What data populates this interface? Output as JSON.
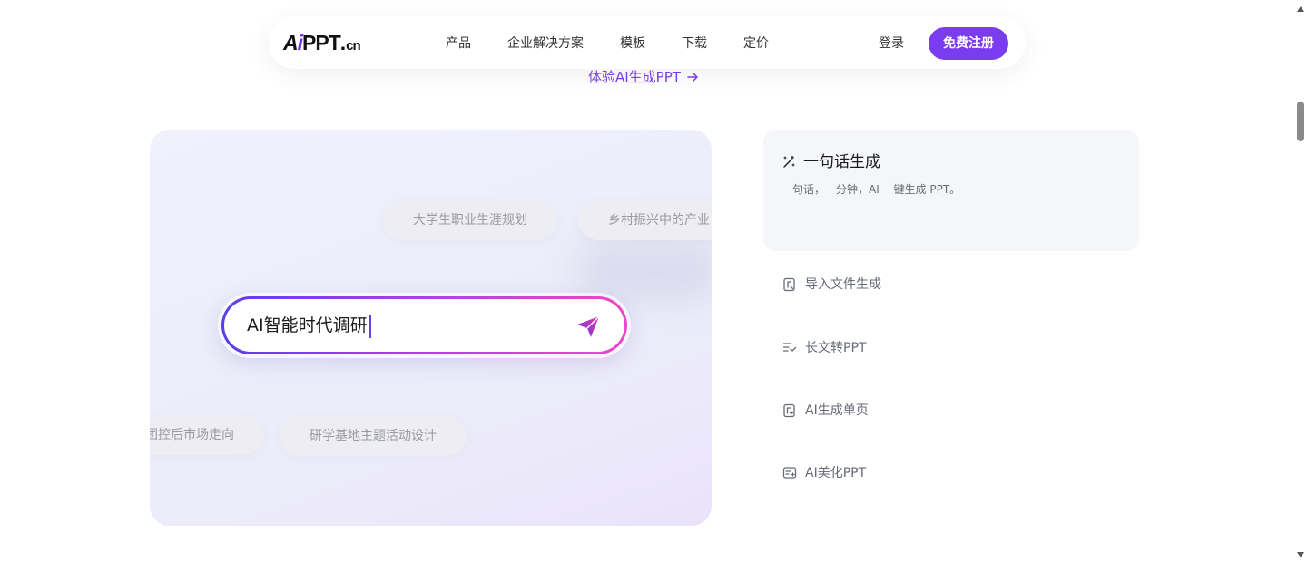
{
  "header": {
    "logo": {
      "a": "A",
      "i": "i",
      "ppt": "PPT",
      "dot": ".",
      "cn": "cn"
    },
    "nav": [
      "产品",
      "企业解决方案",
      "模板",
      "下载",
      "定价"
    ],
    "login_label": "登录",
    "signup_label": "免费注册"
  },
  "try_link": {
    "label": "体验AI生成PPT",
    "icon": "arrow-right-icon"
  },
  "hero": {
    "chips": [
      "大学生职业生涯规划",
      "乡村振兴中的产业",
      "团控后市场走向",
      "研学基地主题活动设计"
    ],
    "prompt_value": "AI智能时代调研",
    "send_icon": "paper-plane-icon"
  },
  "features": {
    "active": {
      "title": "一句话生成",
      "description": "一句话，一分钟，AI 一键生成 PPT。",
      "icon": "magic-wand-icon"
    },
    "items": [
      {
        "label": "导入文件生成",
        "icon": "file-import-icon"
      },
      {
        "label": "长文转PPT",
        "icon": "text-convert-icon"
      },
      {
        "label": "AI生成单页",
        "icon": "single-page-icon"
      },
      {
        "label": "AI美化PPT",
        "icon": "beautify-icon"
      }
    ]
  },
  "colors": {
    "brand": "#7b3cf0",
    "prompt_gradient": [
      "#5b3fe6",
      "#b23ee8",
      "#ee47c9"
    ],
    "feature_active_bg": "#f5f6fa"
  }
}
